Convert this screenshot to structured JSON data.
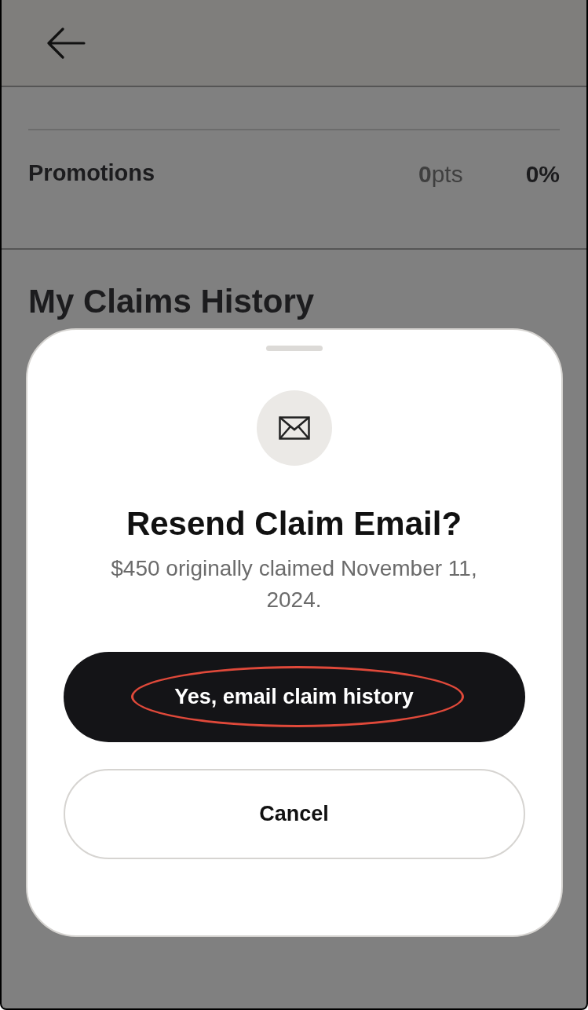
{
  "rows": [
    {
      "label": "Promotions",
      "points": "**0**pts",
      "percent": "0%",
      "kind": "bold"
    }
  ],
  "section": {
    "title": "My Claims History"
  },
  "dialog": {
    "title": "Resend Claim Email?",
    "message": "$450 originally claimed November 11, 2024.",
    "buttons": [
      {
        "label": "Yes, email claim history",
        "kind": "primary",
        "highlighted": true
      },
      {
        "label": "Cancel",
        "kind": "secondary",
        "highlighted": false
      }
    ]
  }
}
